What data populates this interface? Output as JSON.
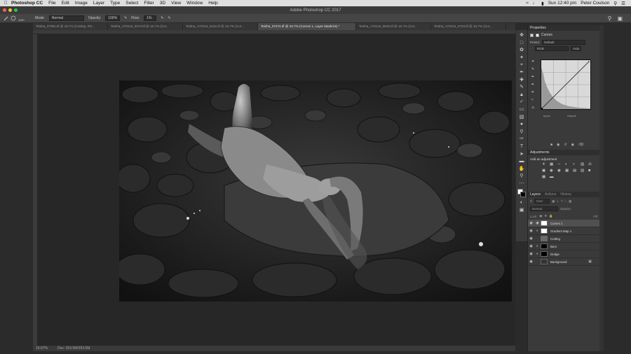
{
  "menubar": {
    "app": "Photoshop CC",
    "items": [
      "File",
      "Edit",
      "Image",
      "Layer",
      "Type",
      "Select",
      "Filter",
      "3D",
      "View",
      "Window",
      "Help"
    ],
    "clock": "Sun 12:40 pm",
    "user": "Peter Coulson"
  },
  "window": {
    "title": "Adobe Photoshop CC 2017"
  },
  "options": {
    "brush_size": "1100",
    "mode_label": "Mode:",
    "mode_value": "Normal",
    "opacity_label": "Opacity:",
    "opacity_value": "100%",
    "flow_label": "Flow:",
    "flow_value": "1%"
  },
  "tabs": [
    {
      "label": "Teisha_07051.tif @ 16.7% (Cutting, RG...",
      "active": false
    },
    {
      "label": "Teisha_170216_0073.tif @ 16.7% (Cur...",
      "active": false
    },
    {
      "label": "Teisha_170216_0162.tif @ 16.7% (Cur...",
      "active": false
    },
    {
      "label": "Teisha_07274.tif @ 16.7% (Curves 1, Layer Mask/16) *",
      "active": true
    },
    {
      "label": "Teisha_170216_0640.tif @ 16.7% (Cur...",
      "active": false
    },
    {
      "label": "Teisha_170216_0723.tif @ 16.7% (Cur...",
      "active": false
    }
  ],
  "status": {
    "zoom": "16.67%",
    "doc": "Doc: 253.5M/253.5M"
  },
  "properties": {
    "header": "Properties",
    "title": "Curves",
    "preset_label": "Preset:",
    "preset_value": "Default",
    "channel": "RGB",
    "auto_label": "Auto",
    "input_label": "Input:",
    "output_label": "Output:"
  },
  "adjustments": {
    "header": "Adjustments",
    "subtitle": "Add an adjustment"
  },
  "layers_panel": {
    "tabs": [
      "Layers",
      "Actions",
      "History"
    ],
    "kind_label": "Kind",
    "blend_mode": "Normal",
    "opacity_label": "Opacity:",
    "lock_label": "Lock:",
    "fill_label": "Fill:",
    "layers": [
      {
        "name": "Curves 1",
        "selected": true,
        "thumb": "#ffffff"
      },
      {
        "name": "Gradient Map 1",
        "selected": false,
        "thumb": "#ffffff"
      },
      {
        "name": "Cutting",
        "selected": false,
        "thumb": "#6a6a6a"
      },
      {
        "name": "Burn",
        "selected": false,
        "thumb": "#000000"
      },
      {
        "name": "Dodge",
        "selected": false,
        "thumb": "#000000"
      },
      {
        "name": "Background",
        "selected": false,
        "thumb": "#333333"
      }
    ]
  }
}
